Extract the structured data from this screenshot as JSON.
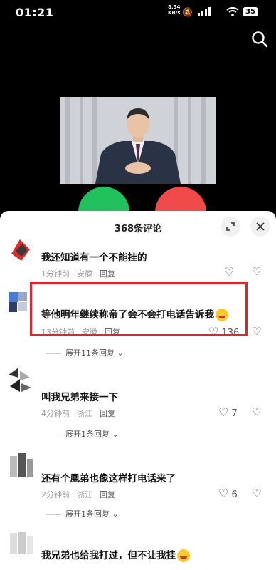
{
  "status_bar": {
    "time": "01:21",
    "net_speed": "8.54",
    "net_unit": "KB/s",
    "battery": "35"
  },
  "icons": {
    "search": "search-icon",
    "expand": "expand-icon",
    "close": "close-icon"
  },
  "comments_panel": {
    "title": "368条评论",
    "comments": [
      {
        "user": "",
        "text": "我还知道有一个不能挂的",
        "time": "1分钟前",
        "location": "安徽",
        "reply": "回复",
        "likes": ""
      },
      {
        "user": "",
        "text": "等他明年继续称帝了会不会打电话告诉我",
        "time": "13分钟前",
        "location": "安徽",
        "reply": "回复",
        "likes": "136",
        "replies_label": "展开11条回复"
      },
      {
        "user": "",
        "text": "叫我兄弟来接一下",
        "time": "4分钟前",
        "location": "浙江",
        "reply": "回复",
        "likes": "7",
        "replies_label": "展开1条回复"
      },
      {
        "user": "",
        "text": "还有个凰弟也像这样打电话来了",
        "time": "2分钟前",
        "location": "浙江",
        "reply": "回复",
        "likes": "6",
        "replies_label": "展开1条回复"
      },
      {
        "user": "",
        "text": "我兄弟也给我打过，但不让我挂",
        "time": "",
        "location": "",
        "reply": "",
        "likes": ""
      }
    ]
  },
  "colors": {
    "highlight_box": "#e5222a",
    "answer_button": "#21c25e",
    "decline_button": "#f04a4a"
  }
}
